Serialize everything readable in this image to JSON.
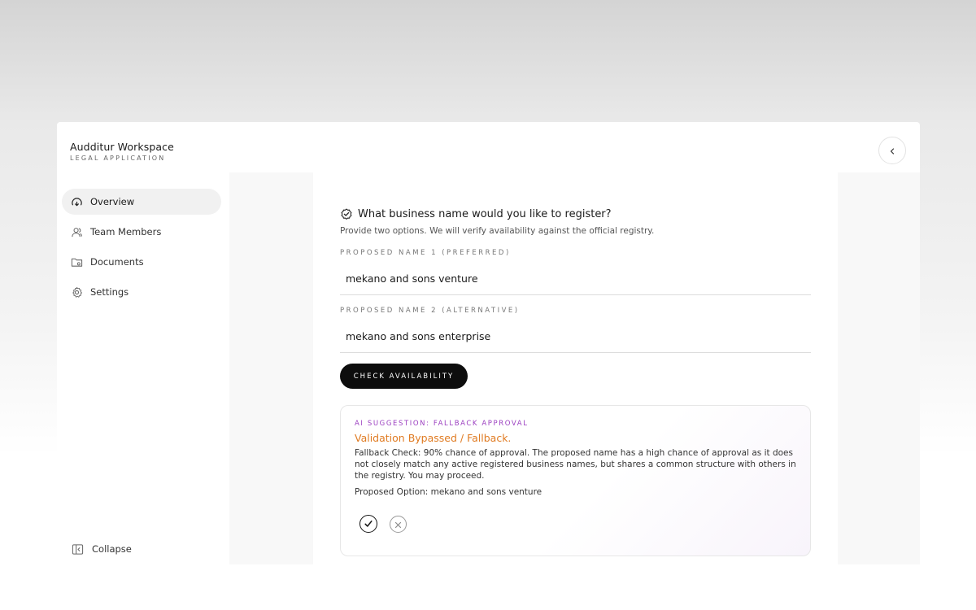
{
  "app": {
    "title": "Audditur Workspace",
    "subtitle": "LEGAL APPLICATION"
  },
  "header": {
    "back_icon": "chevron-left-icon"
  },
  "sidebar": {
    "items": [
      {
        "label": "Overview",
        "icon": "dashboard-gauge-icon",
        "active": true
      },
      {
        "label": "Team Members",
        "icon": "users-icon",
        "active": false
      },
      {
        "label": "Documents",
        "icon": "folder-icon",
        "active": false
      },
      {
        "label": "Settings",
        "icon": "gear-icon",
        "active": false
      }
    ],
    "collapse_label": "Collapse",
    "collapse_icon": "sidebar-panel-icon"
  },
  "form": {
    "question": "What business name would you like to register?",
    "question_icon": "badge-check-icon",
    "hint": "Provide two options. We will verify availability against the official registry.",
    "field1_label": "PROPOSED NAME 1 (PREFERRED)",
    "field1_value": "mekano and sons venture",
    "field2_label": "PROPOSED NAME 2 (ALTERNATIVE)",
    "field2_value": "mekano and sons enterprise",
    "check_button": "CHECK AVAILABILITY"
  },
  "suggestion": {
    "label": "AI SUGGESTION: FALLBACK APPROVAL",
    "title": "Validation Bypassed / Fallback.",
    "body": "Fallback Check: 90% chance of approval. The proposed name has a high chance of approval as it does not closely match any active registered business names, but shares a common structure with others in the registry. You may proceed.",
    "option": "Proposed Option: mekano and sons venture",
    "accept_icon": "check-circle-icon",
    "reject_icon": "x-circle-icon"
  },
  "colors": {
    "accent_purple": "#9b3fc0",
    "warning_orange": "#e07b22",
    "primary_button": "#0d0d0d"
  }
}
